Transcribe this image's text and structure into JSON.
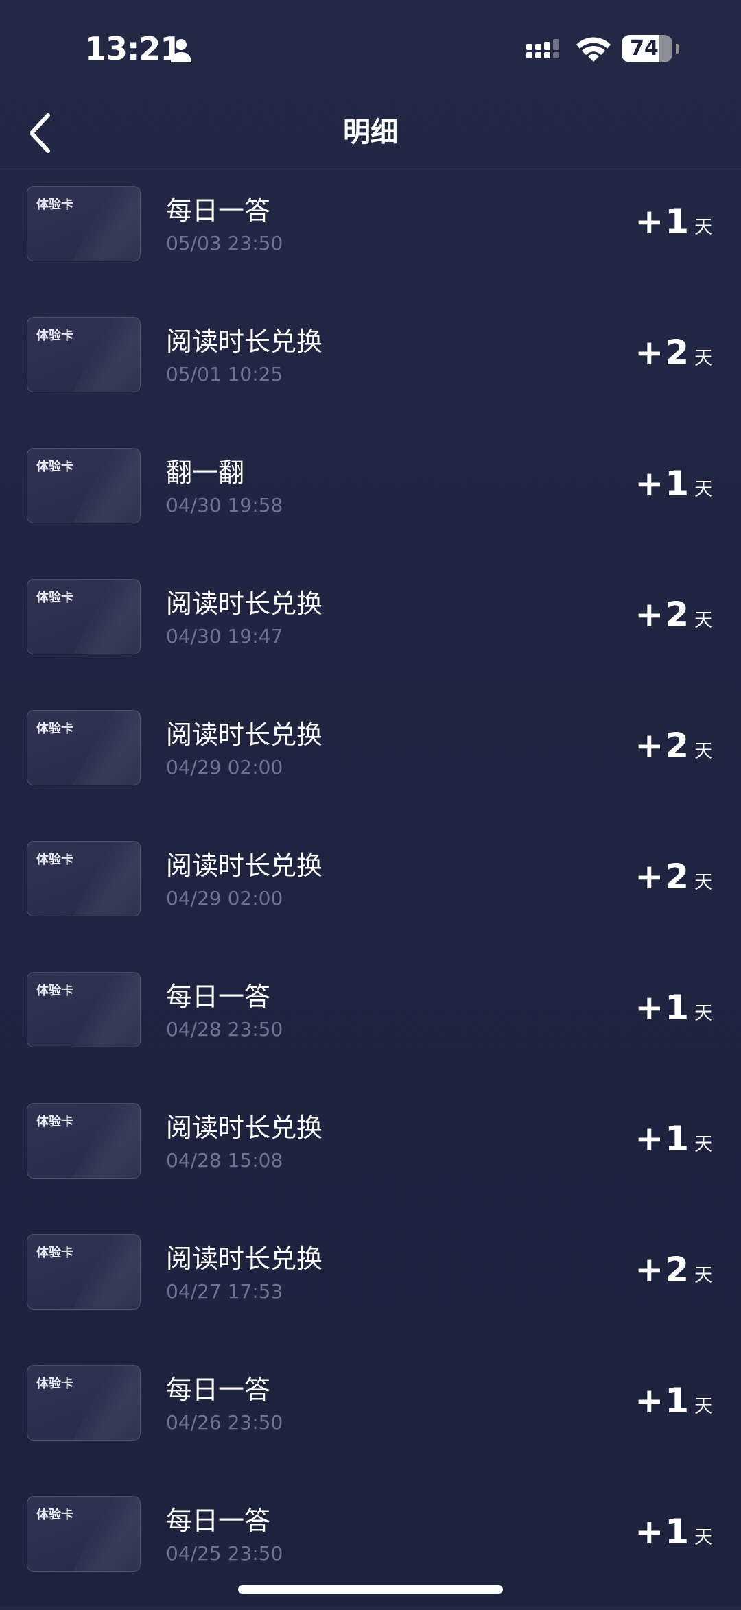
{
  "status_bar": {
    "time": "13:21",
    "battery_level": "74",
    "battery_fraction": 0.74,
    "icons": [
      "person-icon",
      "signal-icon",
      "wifi-icon",
      "battery-icon"
    ]
  },
  "nav": {
    "back_icon": "chevron-left-icon",
    "title": "明细"
  },
  "records": [
    {
      "card_label": "体验卡",
      "title": "每日一答",
      "time": "05/03 23:50",
      "value": "+1",
      "unit": "天"
    },
    {
      "card_label": "体验卡",
      "title": "阅读时长兑换",
      "time": "05/01 10:25",
      "value": "+2",
      "unit": "天"
    },
    {
      "card_label": "体验卡",
      "title": "翻一翻",
      "time": "04/30 19:58",
      "value": "+1",
      "unit": "天"
    },
    {
      "card_label": "体验卡",
      "title": "阅读时长兑换",
      "time": "04/30 19:47",
      "value": "+2",
      "unit": "天"
    },
    {
      "card_label": "体验卡",
      "title": "阅读时长兑换",
      "time": "04/29 02:00",
      "value": "+2",
      "unit": "天"
    },
    {
      "card_label": "体验卡",
      "title": "阅读时长兑换",
      "time": "04/29 02:00",
      "value": "+2",
      "unit": "天"
    },
    {
      "card_label": "体验卡",
      "title": "每日一答",
      "time": "04/28 23:50",
      "value": "+1",
      "unit": "天"
    },
    {
      "card_label": "体验卡",
      "title": "阅读时长兑换",
      "time": "04/28 15:08",
      "value": "+1",
      "unit": "天"
    },
    {
      "card_label": "体验卡",
      "title": "阅读时长兑换",
      "time": "04/27 17:53",
      "value": "+2",
      "unit": "天"
    },
    {
      "card_label": "体验卡",
      "title": "每日一答",
      "time": "04/26 23:50",
      "value": "+1",
      "unit": "天"
    },
    {
      "card_label": "体验卡",
      "title": "每日一答",
      "time": "04/25 23:50",
      "value": "+1",
      "unit": "天"
    }
  ],
  "colors": {
    "background": "#1f2540",
    "text_primary": "#ffffff",
    "text_secondary": "#6e7390"
  }
}
